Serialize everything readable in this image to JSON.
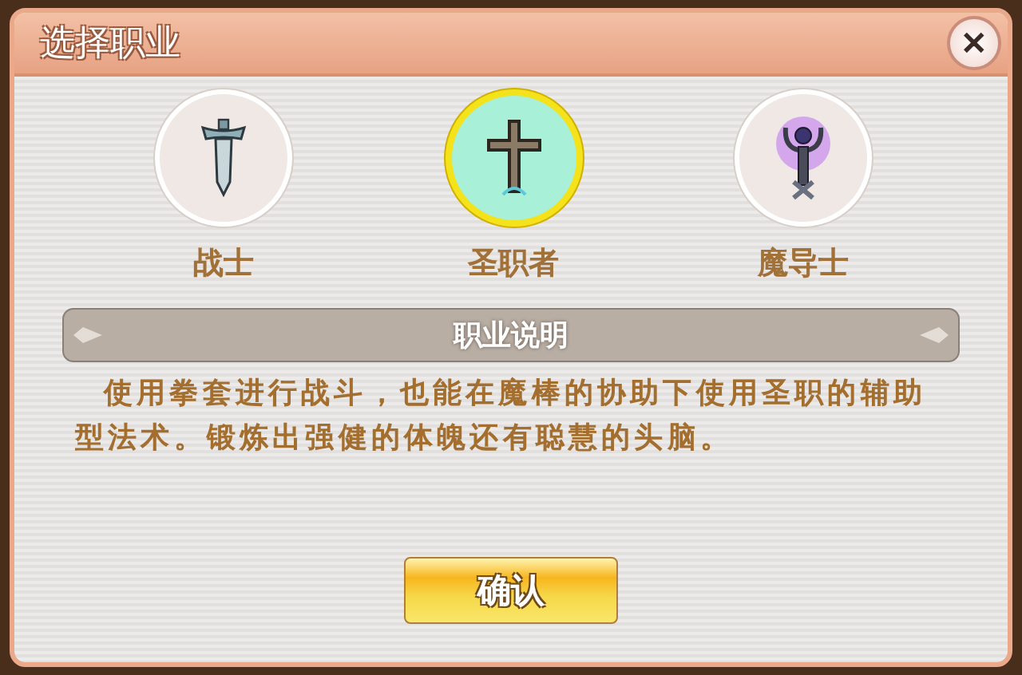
{
  "window": {
    "title": "选择职业",
    "close": "✕"
  },
  "classes": [
    {
      "label": "战士",
      "kind": "sword",
      "selected": false
    },
    {
      "label": "圣职者",
      "kind": "cross",
      "selected": true
    },
    {
      "label": "魔导士",
      "kind": "staff",
      "selected": false
    }
  ],
  "description": {
    "heading": "职业说明",
    "text": "使用拳套进行战斗，也能在魔棒的协助下使用圣职的辅助型法术。锻炼出强健的体魄还有聪慧的头脑。"
  },
  "buttons": [
    "确认"
  ]
}
